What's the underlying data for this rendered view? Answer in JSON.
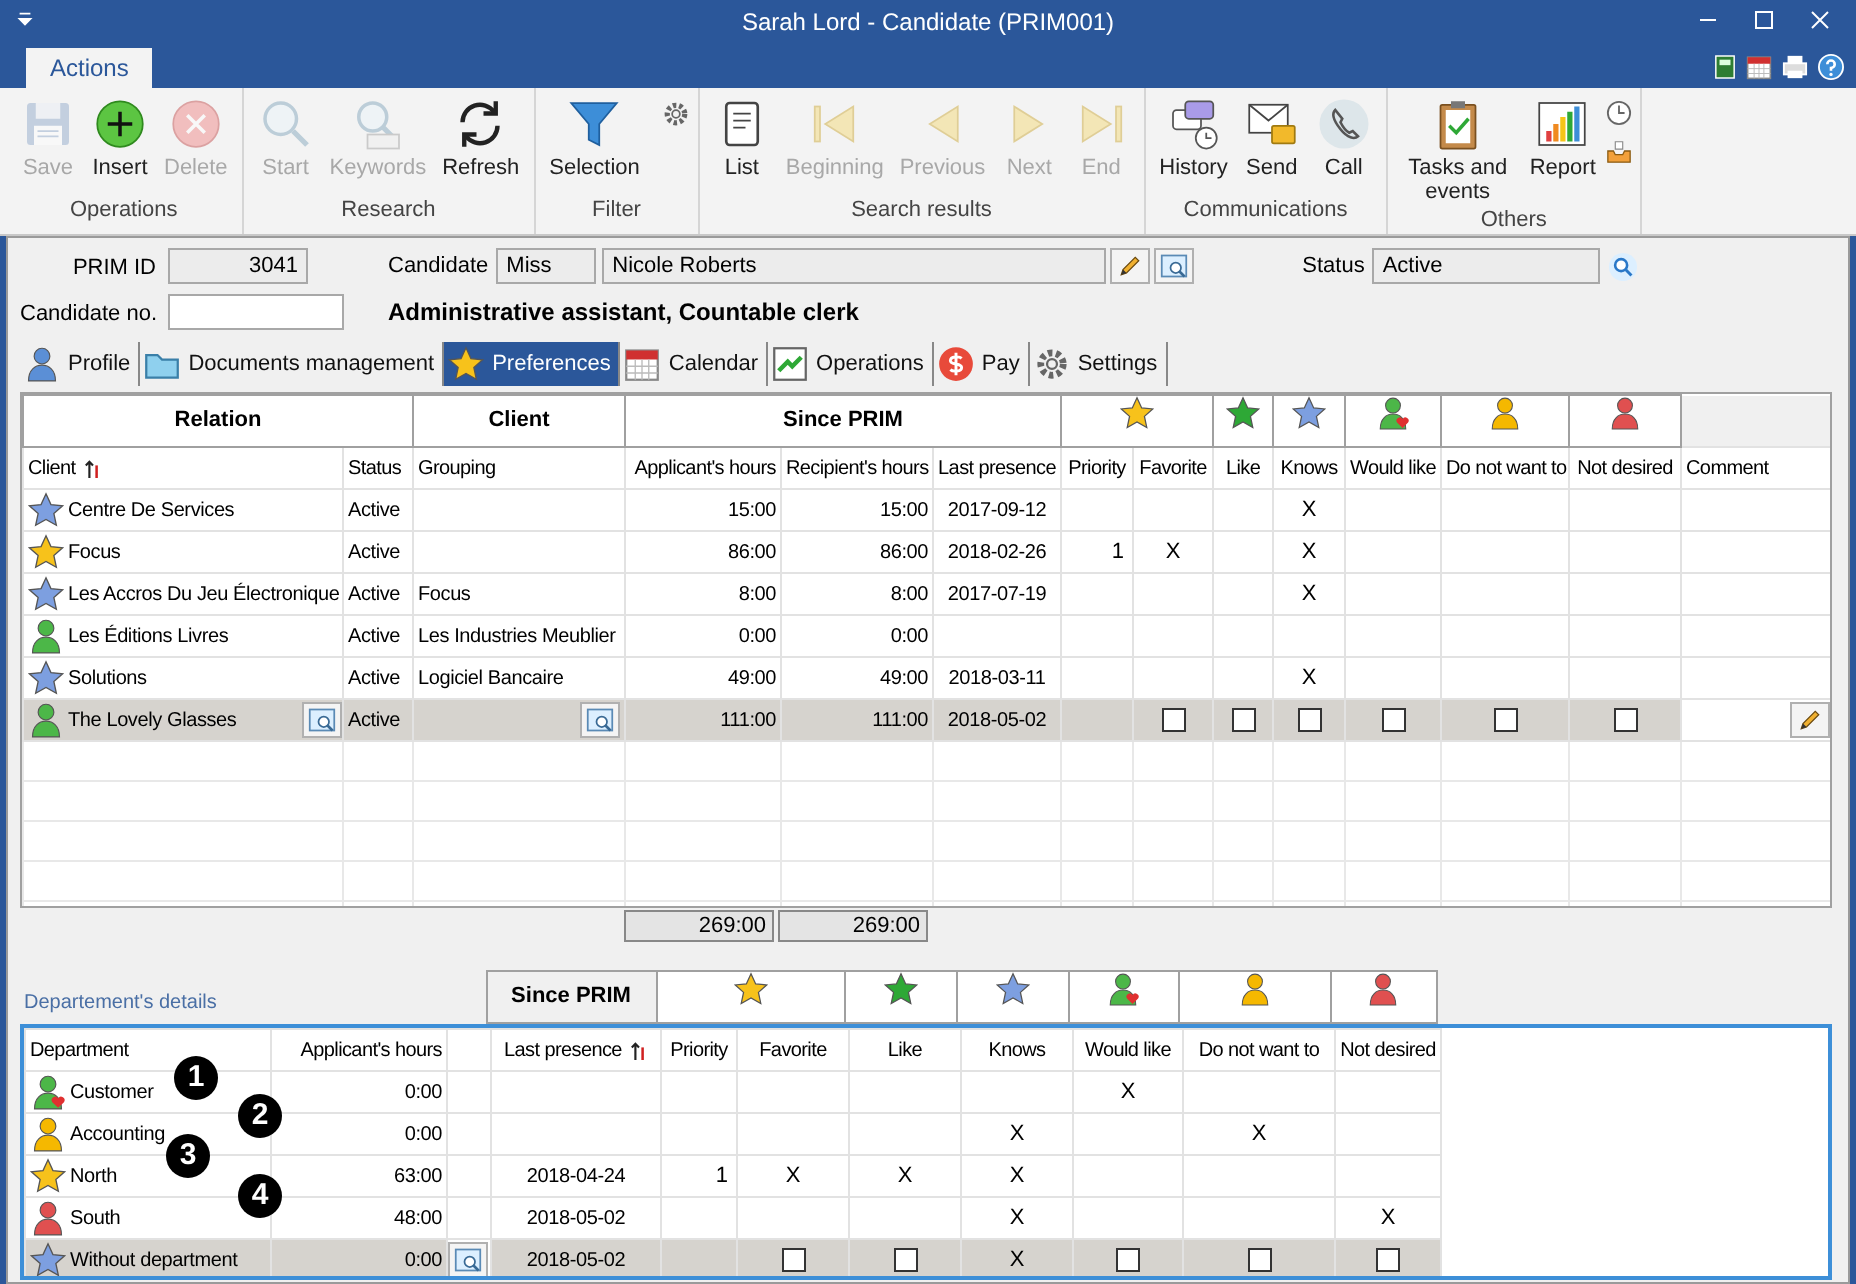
{
  "window": {
    "title": "Sarah Lord - Candidate (PRIM001)"
  },
  "ribbon": {
    "tab": "Actions",
    "groups": [
      {
        "label": "Operations",
        "buttons": [
          {
            "label": "Save",
            "kind": "save",
            "disabled": true
          },
          {
            "label": "Insert",
            "kind": "insert",
            "disabled": false
          },
          {
            "label": "Delete",
            "kind": "delete",
            "disabled": true
          }
        ]
      },
      {
        "label": "Research",
        "buttons": [
          {
            "label": "Start",
            "kind": "search",
            "disabled": true
          },
          {
            "label": "Keywords",
            "kind": "keywords",
            "disabled": true
          },
          {
            "label": "Refresh",
            "kind": "refresh",
            "disabled": false
          }
        ]
      },
      {
        "label": "Filter",
        "buttons": [
          {
            "label": "Selection",
            "kind": "filter",
            "disabled": false
          }
        ]
      },
      {
        "label": "Search results",
        "buttons": [
          {
            "label": "List",
            "kind": "list",
            "disabled": false
          },
          {
            "label": "Beginning",
            "kind": "first",
            "disabled": true
          },
          {
            "label": "Previous",
            "kind": "previous",
            "disabled": true
          },
          {
            "label": "Next",
            "kind": "next",
            "disabled": true
          },
          {
            "label": "End",
            "kind": "last",
            "disabled": true
          }
        ]
      },
      {
        "label": "Communications",
        "buttons": [
          {
            "label": "History",
            "kind": "history",
            "disabled": false
          },
          {
            "label": "Send",
            "kind": "send",
            "disabled": false
          },
          {
            "label": "Call",
            "kind": "call",
            "disabled": false
          }
        ]
      },
      {
        "label": "Others",
        "buttons": [
          {
            "label": "Tasks and events",
            "kind": "tasks",
            "disabled": false
          },
          {
            "label": "Report",
            "kind": "report",
            "disabled": false
          }
        ]
      }
    ]
  },
  "form": {
    "prim_id_label": "PRIM ID",
    "prim_id": "3041",
    "candidate_label": "Candidate",
    "salutation": "Miss",
    "name": "Nicole Roberts",
    "status_label": "Status",
    "status": "Active",
    "candidate_no_label": "Candidate no.",
    "positions": "Administrative assistant, Countable clerk"
  },
  "tabs": [
    {
      "label": "Profile",
      "kind": "profile",
      "selected": false
    },
    {
      "label": "Documents management",
      "kind": "documents",
      "selected": false
    },
    {
      "label": "Preferences",
      "kind": "preferences",
      "selected": true
    },
    {
      "label": "Calendar",
      "kind": "calendar",
      "selected": false
    },
    {
      "label": "Operations",
      "kind": "operations",
      "selected": false
    },
    {
      "label": "Pay",
      "kind": "pay",
      "selected": false
    },
    {
      "label": "Settings",
      "kind": "settings",
      "selected": false
    }
  ],
  "clients": {
    "groups": [
      "Relation",
      "Client",
      "Since PRIM"
    ],
    "preference_icons": [
      {
        "kind": "star",
        "color": "#f7c21b"
      },
      {
        "kind": "star",
        "color": "#2ea836"
      },
      {
        "kind": "star",
        "color": "#7d9fe0"
      },
      {
        "kind": "person-heart",
        "color": "#4cb748"
      },
      {
        "kind": "person",
        "color": "#f5b800"
      },
      {
        "kind": "person",
        "color": "#e05050"
      }
    ],
    "columns": [
      {
        "label": "Client",
        "sorted": true
      },
      {
        "label": "Status",
        "sorted": false
      },
      {
        "label": "Grouping",
        "sorted": false
      },
      {
        "label": "Applicant's hours",
        "sorted": false
      },
      {
        "label": "Recipient's hours",
        "sorted": false
      },
      {
        "label": "Last presence",
        "sorted": false
      },
      {
        "label": "Priority",
        "sorted": false
      },
      {
        "label": "Favorite",
        "sorted": false
      },
      {
        "label": "Like",
        "sorted": false
      },
      {
        "label": "Knows",
        "sorted": false
      },
      {
        "label": "Would like",
        "sorted": false
      },
      {
        "label": "Do not want to",
        "sorted": false
      },
      {
        "label": "Not desired",
        "sorted": false
      },
      {
        "label": "Comment",
        "sorted": false
      }
    ],
    "rows": [
      {
        "kind": "star",
        "color": "#7d9fe0",
        "client": "Centre De Services",
        "status": "Active",
        "applicant_hours": "15:00",
        "recipient_hours": "15:00",
        "last_presence": "2017-09-12",
        "prefs": {
          "knows": "X"
        },
        "selected": false
      },
      {
        "kind": "star",
        "color": "#f7c21b",
        "client": "Focus",
        "status": "Active",
        "applicant_hours": "86:00",
        "recipient_hours": "86:00",
        "last_presence": "2018-02-26",
        "prefs": {
          "priority": "1",
          "favorite": "X",
          "knows": "X"
        },
        "selected": false
      },
      {
        "kind": "star",
        "color": "#7d9fe0",
        "client": "Les Accros Du Jeu Électronique",
        "status": "Active",
        "grouping": "Focus",
        "applicant_hours": "8:00",
        "recipient_hours": "8:00",
        "last_presence": "2017-07-19",
        "prefs": {
          "knows": "X"
        },
        "selected": false
      },
      {
        "kind": "person",
        "color": "#4cb748",
        "client": "Les Éditions Livres",
        "status": "Active",
        "grouping": "Les Industries Meublier",
        "applicant_hours": "0:00",
        "recipient_hours": "0:00",
        "prefs": {},
        "selected": false
      },
      {
        "kind": "star",
        "color": "#7d9fe0",
        "client": "Solutions",
        "status": "Active",
        "grouping": "Logiciel Bancaire",
        "applicant_hours": "49:00",
        "recipient_hours": "49:00",
        "last_presence": "2018-03-11",
        "prefs": {
          "knows": "X"
        },
        "selected": false
      },
      {
        "kind": "person",
        "color": "#4cb748",
        "client": "The Lovely Glasses",
        "status": "Active",
        "applicant_hours": "111:00",
        "recipient_hours": "111:00",
        "last_presence": "2018-05-02",
        "prefs": {
          "favorite": false,
          "like": false,
          "knows": false,
          "would_like": false,
          "do_not_want": false,
          "not_desired": false
        },
        "selected": true
      }
    ],
    "totals": [
      "269:00",
      "269:00"
    ]
  },
  "departments": {
    "title": "Departement's details",
    "group": "Since PRIM",
    "preference_icons": [
      {
        "kind": "star",
        "color": "#f7c21b"
      },
      {
        "kind": "star",
        "color": "#2ea836"
      },
      {
        "kind": "star",
        "color": "#7d9fe0"
      },
      {
        "kind": "person-heart",
        "color": "#4cb748"
      },
      {
        "kind": "person",
        "color": "#f5b800"
      },
      {
        "kind": "person",
        "color": "#e05050"
      }
    ],
    "columns": [
      {
        "label": "Department",
        "sorted": false
      },
      {
        "label": "Applicant's hours",
        "sorted": false
      },
      {
        "label": "Last presence",
        "sorted": true
      },
      {
        "label": "Priority",
        "sorted": false
      },
      {
        "label": "Favorite",
        "sorted": false
      },
      {
        "label": "Like",
        "sorted": false
      },
      {
        "label": "Knows",
        "sorted": false
      },
      {
        "label": "Would like",
        "sorted": false
      },
      {
        "label": "Do not want to",
        "sorted": false
      },
      {
        "label": "Not desired",
        "sorted": false
      }
    ],
    "rows": [
      {
        "kind": "person-heart",
        "color": "#4cb748",
        "department": "Customer",
        "applicant_hours": "0:00",
        "prefs": {
          "would_like": "X"
        },
        "selected": false
      },
      {
        "kind": "person",
        "color": "#f5b800",
        "department": "Accounting",
        "applicant_hours": "0:00",
        "prefs": {
          "knows": "X",
          "do_not_want": "X"
        },
        "selected": false
      },
      {
        "kind": "star",
        "color": "#f7c21b",
        "department": "North",
        "applicant_hours": "63:00",
        "last_presence": "2018-04-24",
        "prefs": {
          "priority": "1",
          "favorite": "X",
          "like": "X",
          "knows": "X"
        },
        "selected": false
      },
      {
        "kind": "person",
        "color": "#e05050",
        "department": "South",
        "applicant_hours": "48:00",
        "last_presence": "2018-05-02",
        "prefs": {
          "knows": "X",
          "not_desired": "X"
        },
        "selected": false
      },
      {
        "kind": "star",
        "color": "#7d9fe0",
        "department": "Without department",
        "applicant_hours": "0:00",
        "last_presence": "2018-05-02",
        "prefs": {
          "favorite": false,
          "like": false,
          "knows": "X",
          "would_like": false,
          "do_not_want": false,
          "not_desired": false
        },
        "selected": true
      }
    ]
  },
  "callouts": [
    "1",
    "2",
    "3",
    "4"
  ]
}
